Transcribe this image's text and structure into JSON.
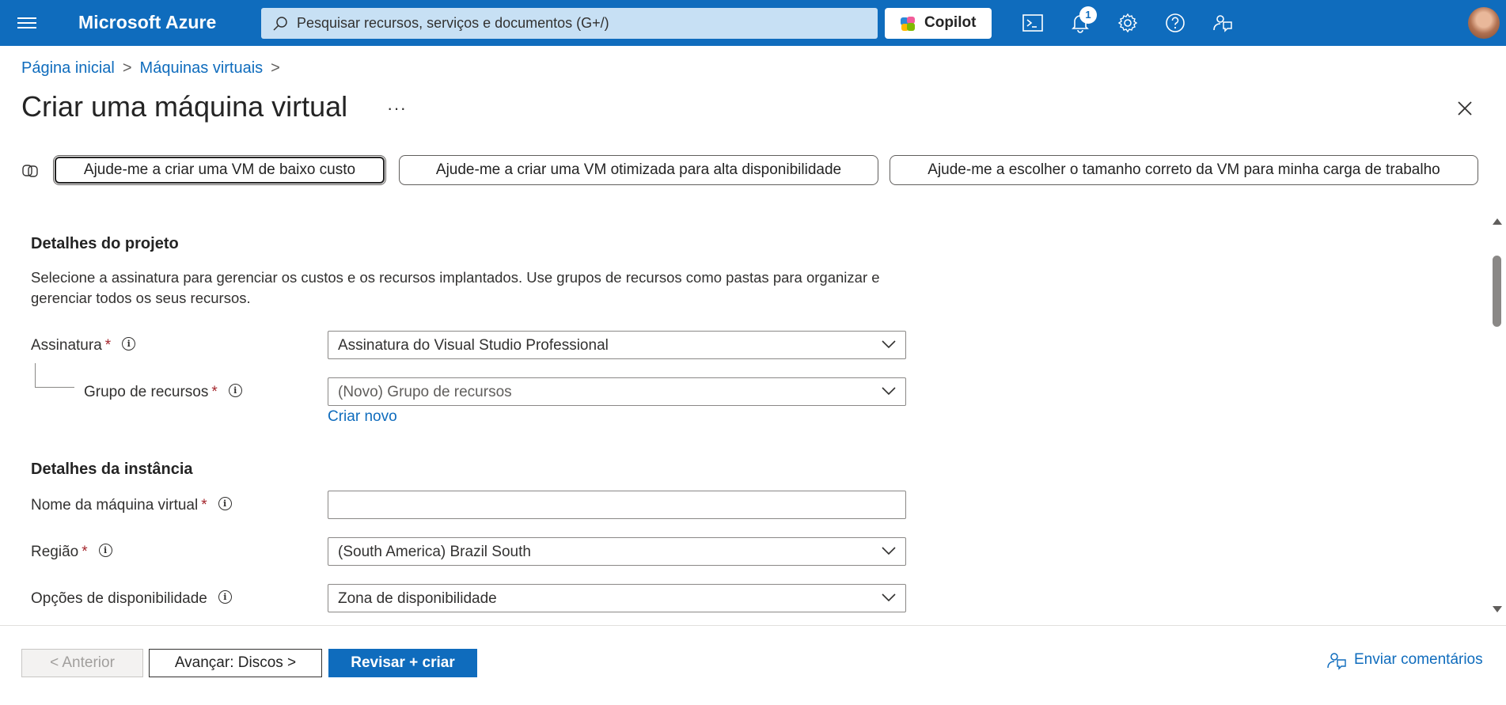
{
  "topbar": {
    "brand": "Microsoft Azure",
    "search_placeholder": "Pesquisar recursos, serviços e documentos (G+/)",
    "copilot_label": "Copilot",
    "notifications_count": "1",
    "icons": [
      "menu-icon",
      "cloud-shell-icon",
      "notifications-icon",
      "settings-icon",
      "help-icon",
      "feedback-icon"
    ],
    "accent_color": "#0F6CBD"
  },
  "breadcrumb": {
    "items": [
      "Página inicial",
      "Máquinas virtuais"
    ]
  },
  "page": {
    "title": "Criar uma máquina virtual",
    "more": "···"
  },
  "suggestions": [
    "Ajude-me a criar uma VM de baixo custo",
    "Ajude-me a criar uma VM otimizada para alta disponibilidade",
    "Ajude-me a escolher o tamanho correto da VM para minha carga de trabalho"
  ],
  "project": {
    "title": "Detalhes do projeto",
    "description": "Selecione a assinatura para gerenciar os custos e os recursos implantados. Use grupos de recursos como pastas para organizar e gerenciar todos os seus recursos.",
    "subscription_label": "Assinatura",
    "subscription_value": "Assinatura do Visual Studio Professional",
    "rg_label": "Grupo de recursos",
    "rg_value": "(Novo) Grupo de recursos",
    "create_new": "Criar novo"
  },
  "instance": {
    "title": "Detalhes da instância",
    "vm_name_label": "Nome da máquina virtual",
    "vm_name_value": "",
    "region_label": "Região",
    "region_value": "(South America) Brazil South",
    "availability_label": "Opções de disponibilidade",
    "availability_value": "Zona de disponibilidade"
  },
  "footer": {
    "prev": "< Anterior",
    "next": "Avançar: Discos >",
    "review": "Revisar + criar",
    "feedback": "Enviar comentários"
  }
}
